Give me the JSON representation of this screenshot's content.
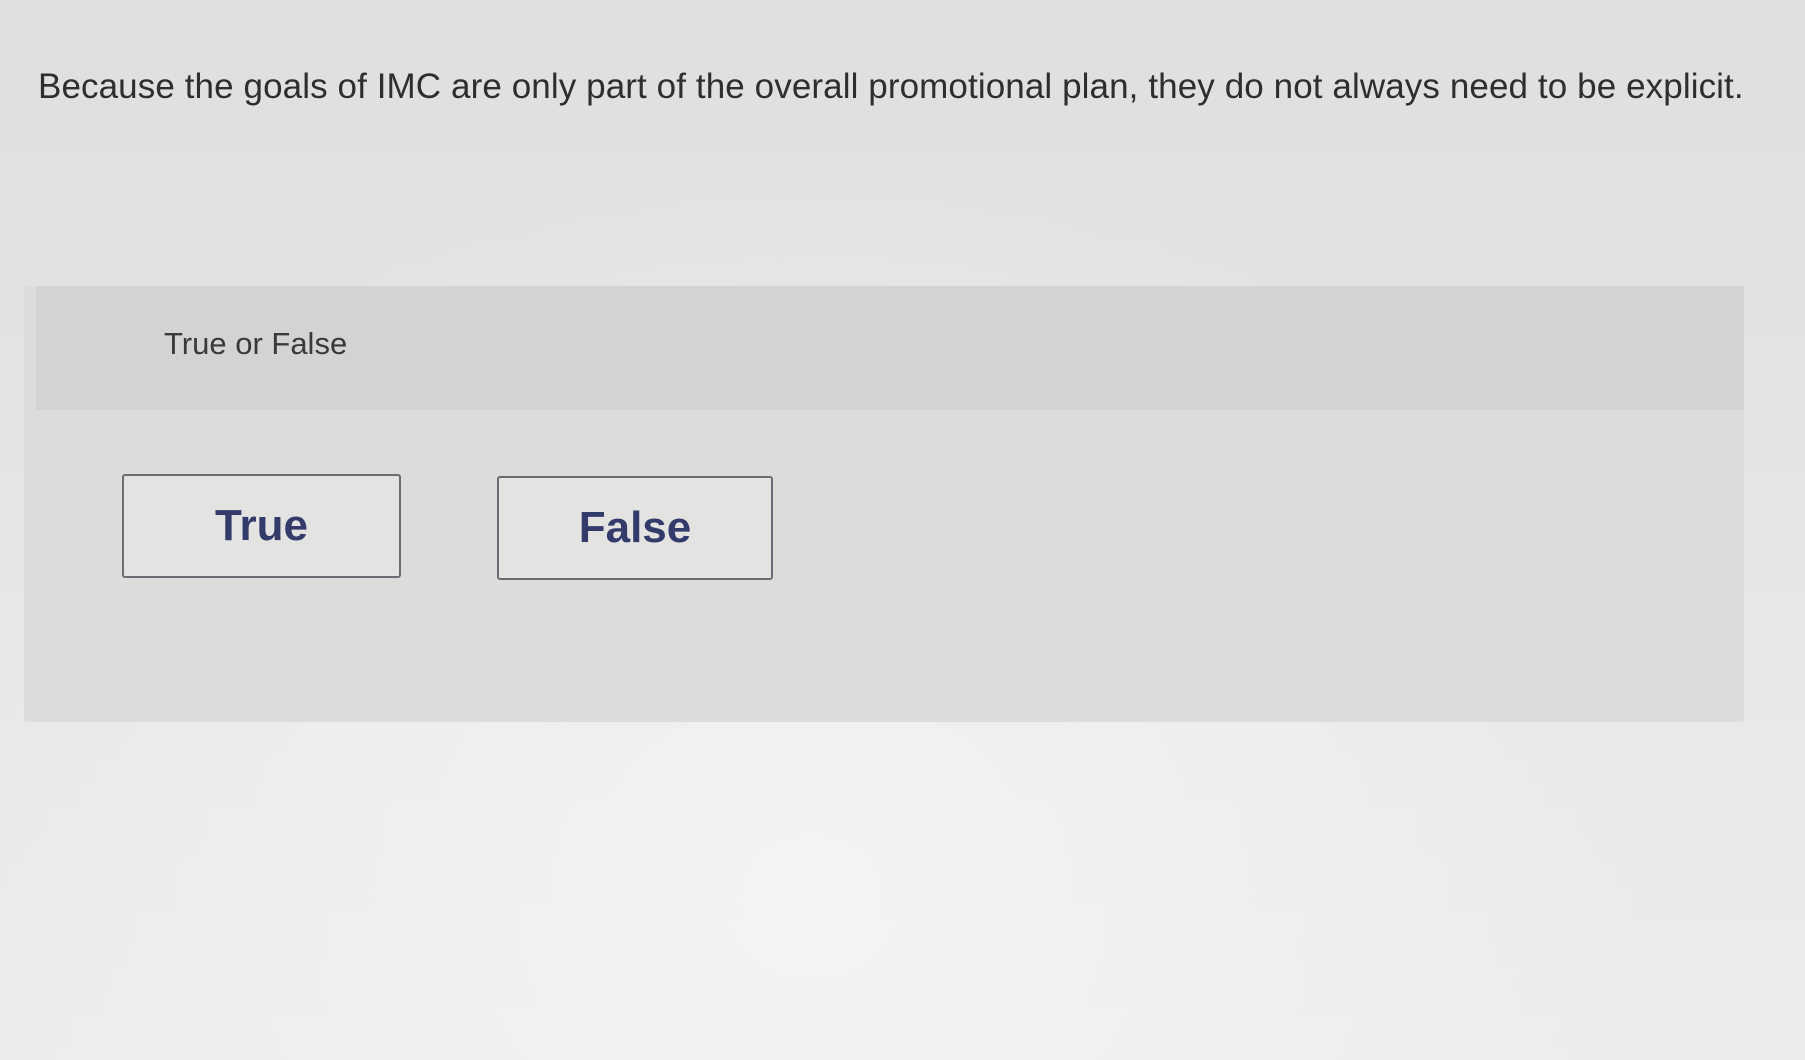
{
  "question": {
    "text": "Because the goals of IMC are only part of the overall promotional plan, they do not always need to be explicit."
  },
  "answer_panel": {
    "prompt": "True or False",
    "options": [
      {
        "label": "True"
      },
      {
        "label": "False"
      }
    ]
  },
  "colors": {
    "button_text": "#333b6b",
    "button_border": "#6a6e74",
    "panel_background": "#dcdcda",
    "panel_header_background": "#d3d3d1"
  }
}
